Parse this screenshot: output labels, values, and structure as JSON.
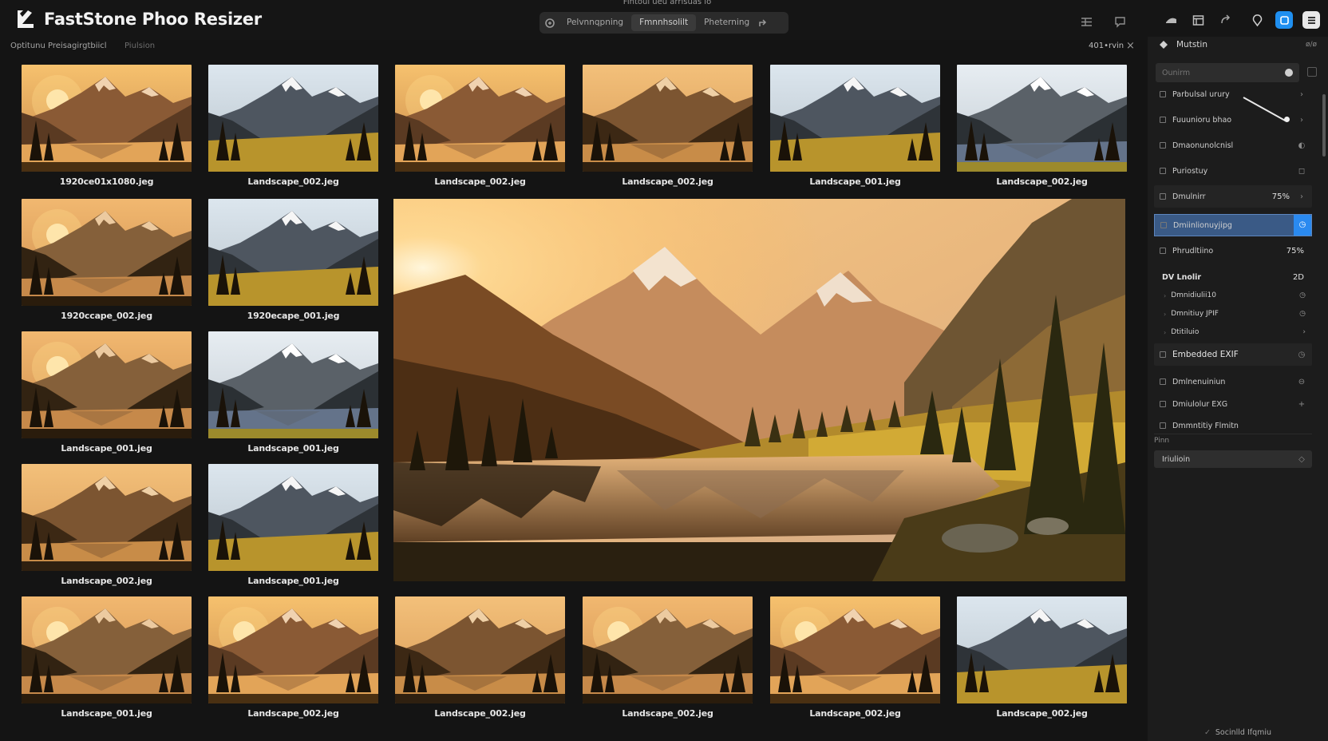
{
  "app": {
    "title": "FastStone Phoo Resizer",
    "top_caption": "Fintoul ueu arrisuas lo"
  },
  "toolbar": {
    "segments": [
      "Pelvnnqpning",
      "Fmnnhsolilt",
      "Pheterning"
    ],
    "active_segment": 1
  },
  "subbar": {
    "breadcrumb": "Optitunu Preisagirgtbiicl",
    "breadcrumb_secondary": "Piulsion",
    "count": "401•rvin",
    "close": "×"
  },
  "thumbnails": [
    {
      "caption": "1920ce01x1080.jeg",
      "scene": "sunrise"
    },
    {
      "caption": "Landscape_002.jeg",
      "scene": "snow"
    },
    {
      "caption": "Landscape_002.jeg",
      "scene": "sunrise"
    },
    {
      "caption": "Landscape_002.jeg",
      "scene": "lake"
    },
    {
      "caption": "Landscape_001.jeg",
      "scene": "snow"
    },
    {
      "caption": "Landscape_002.jeg",
      "scene": "snow-lake"
    },
    {
      "caption": "1920ccape_002.jeg",
      "scene": "forest-lake"
    },
    {
      "caption": "1920ecape_001.jeg",
      "scene": "snow"
    },
    {
      "caption": "Landscape_001.jeg",
      "scene": "forest-lake"
    },
    {
      "caption": "Landscape_001.jeg",
      "scene": "snow-lake"
    },
    {
      "caption": "Landscape_002.jeg",
      "scene": "lake"
    },
    {
      "caption": "Landscape_001.jeg",
      "scene": "snow"
    },
    {
      "caption": "Landscape_001.jeg",
      "scene": "forest-lake"
    },
    {
      "caption": "Landscape_002.jeg",
      "scene": "sunrise"
    },
    {
      "caption": "Landscape_002.jeg",
      "scene": "lake"
    },
    {
      "caption": "Landscape_002.jeg",
      "scene": "forest-lake"
    },
    {
      "caption": "Landscape_002.jeg",
      "scene": "sunrise"
    },
    {
      "caption": "Landscape_002.jeg",
      "scene": "snow"
    }
  ],
  "panel": {
    "header": "Mutstin",
    "header_right": "ø/ø",
    "search_placeholder": "Ounirm",
    "rows": [
      {
        "label": "Parbulsal urury",
        "tail": "›"
      },
      {
        "label": "Fuuunioru bhao",
        "tail": "›"
      },
      {
        "label": "Dmaonunolcnisl",
        "tail": "◐"
      },
      {
        "label": "Puriostuy",
        "tail": "◻"
      },
      {
        "label": "Dmulnirr",
        "value": "75%",
        "tail": "›"
      },
      {
        "label": "Dmiinlionuyjipg",
        "tail": "◷"
      },
      {
        "label": "Phrudltiino",
        "value": "75%"
      }
    ],
    "group_label": "DV Lnolir",
    "group_value": "2D",
    "sub_items": [
      {
        "label": "Dmnidiulii10",
        "tail": "◷"
      },
      {
        "label": "Dmnitiuy JPIF",
        "tail": "◷"
      },
      {
        "label": "Dtitiluio",
        "tail": "›"
      }
    ],
    "rows2": [
      {
        "label": "Embedded EXIF",
        "tail": "◷"
      },
      {
        "label": "Dmlnenuiniun",
        "tail": "⊖"
      },
      {
        "label": "Dmiulolur EXG",
        "tail": "+"
      },
      {
        "label": "Dmmntitiy Flmitn",
        "tail": ""
      }
    ],
    "section_label": "Pinn",
    "bottom_select": "Iriulioin",
    "footer": "Socinlld Ifqmiu"
  },
  "colors": {
    "accent": "#2a8af0",
    "selected_row": "#3a5a86",
    "panel_bg": "#1c1c1c",
    "app_bg": "#141414"
  }
}
